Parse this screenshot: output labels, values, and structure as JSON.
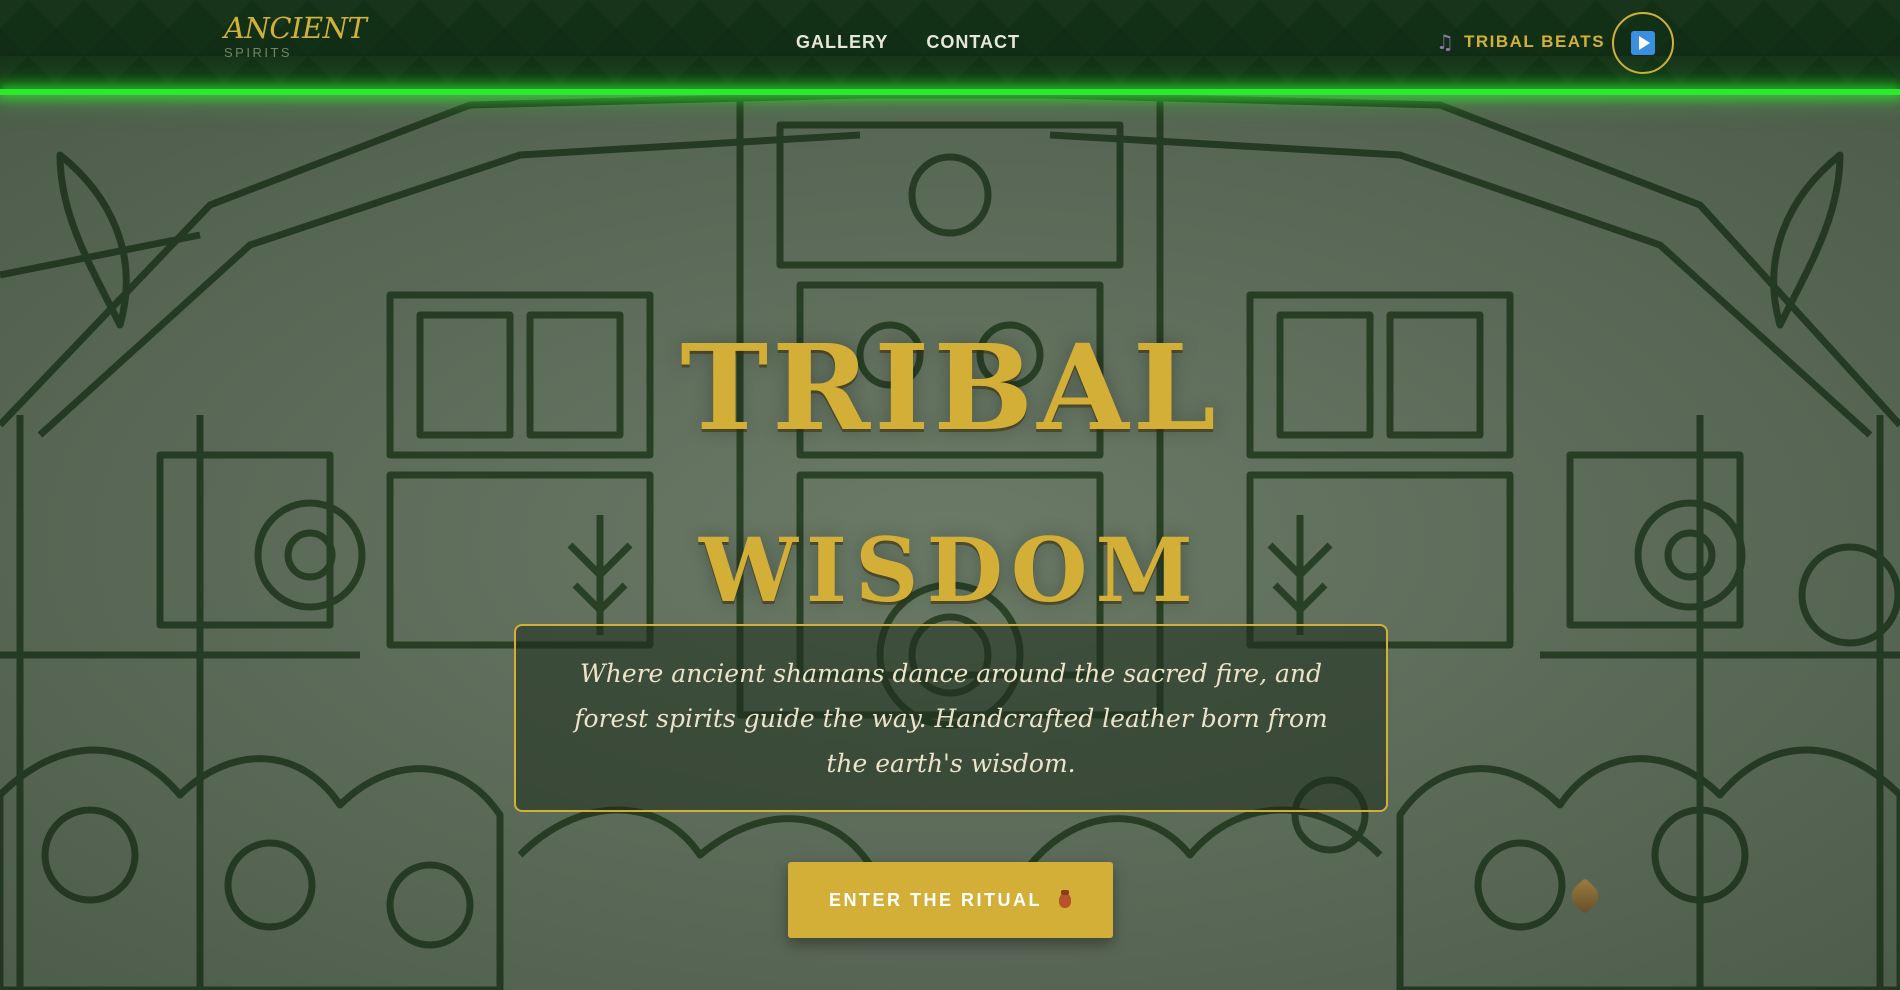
{
  "navbar": {
    "brand_main": "ANCIENT",
    "brand_sub": "SPIRITS",
    "links": [
      {
        "label": "GALLERY"
      },
      {
        "label": "CONTACT"
      }
    ],
    "music_icon": "music-note-icon",
    "music_label": "TRIBAL BEATS",
    "play_icon": "play-icon",
    "glow_color": "#2ee82e"
  },
  "hero": {
    "title_line1": "TRIBAL",
    "title_line2": "WISDOM",
    "tagline": "Where ancient shamans dance around the sacred fire, and forest spirits guide the way. Handcrafted leather born from the earth's wisdom.",
    "cta_label": "ENTER THE RITUAL",
    "cta_icon": "clay-pot-icon",
    "accent_color": "#d4af37"
  }
}
